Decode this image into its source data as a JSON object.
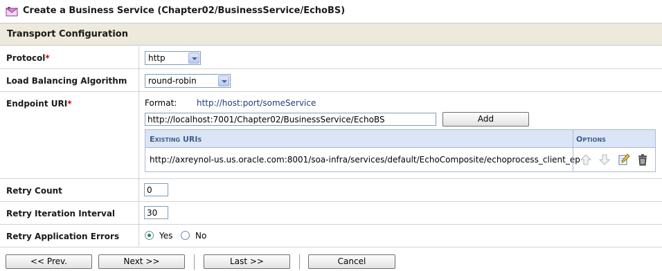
{
  "title": "Create a Business Service (Chapter02/BusinessService/EchoBS)",
  "section_title": "Transport Configuration",
  "protocol": {
    "label": "Protocol",
    "required_mark": "*",
    "value": "http"
  },
  "load_balancing": {
    "label": "Load Balancing Algorithm",
    "value": "round-robin"
  },
  "endpoint": {
    "label": "Endpoint URI",
    "required_mark": "*",
    "format_label": "Format:",
    "format_value": "http://host:port/someService",
    "input_value": "http://localhost:7001/Chapter02/BusinessService/EchoBS",
    "add_button": "Add",
    "table": {
      "col_uris": "Existing URIs",
      "col_options": "Options",
      "rows": [
        {
          "uri": "http://axreynol-us.us.oracle.com:8001/soa-infra/services/default/EchoComposite/echoprocess_client_ep"
        }
      ]
    }
  },
  "retry_count": {
    "label": "Retry Count",
    "value": "0"
  },
  "retry_interval": {
    "label": "Retry Iteration Interval",
    "value": "30"
  },
  "retry_app_errors": {
    "label": "Retry Application Errors",
    "yes": "Yes",
    "no": "No",
    "selected": "Yes"
  },
  "footer": {
    "prev": "<< Prev.",
    "next": "Next >>",
    "last": "Last >>",
    "cancel": "Cancel"
  },
  "icons": {
    "title": "business-service-icon",
    "up": "move-up-arrow-icon",
    "down": "move-down-arrow-icon",
    "edit": "edit-icon",
    "delete": "trash-icon"
  },
  "colors": {
    "required": "#cc0000",
    "section_bg": "#ede9dc",
    "table_head_bg": "#dbe5f6",
    "link_blue": "#1f3f7a"
  }
}
